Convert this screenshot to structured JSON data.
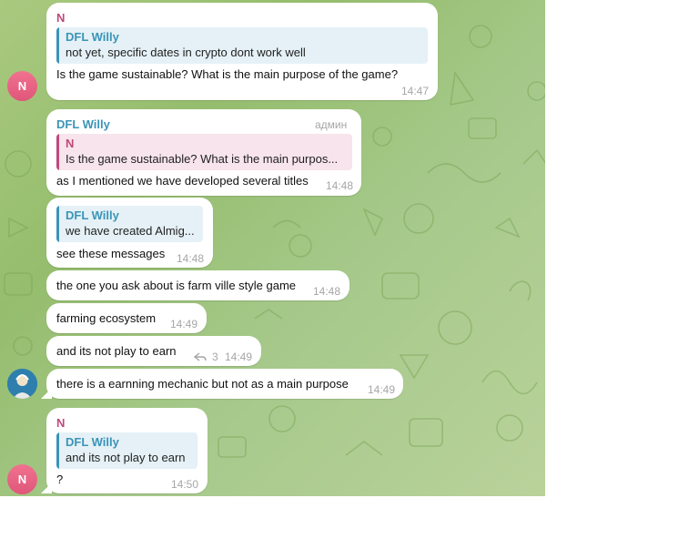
{
  "messages": [
    {
      "sender": "N",
      "quote": {
        "author": "DFL Willy",
        "text": "not yet, specific dates in crypto dont work well"
      },
      "text": "Is the game sustainable? What is the main purpose of the game?",
      "time": "14:47",
      "avatar": "N"
    },
    {
      "sender": "DFL Willy",
      "role": "админ",
      "quote": {
        "author": "N",
        "text": "Is the game sustainable? What is the main purpos..."
      },
      "text": "as I mentioned we have developed several titles",
      "time": "14:48"
    },
    {
      "quote": {
        "author": "DFL Willy",
        "text": "we have created Almig..."
      },
      "text": "see these messages",
      "time": "14:48"
    },
    {
      "text": "the one you ask about is farm ville style game",
      "time": "14:48"
    },
    {
      "text": "farming ecosystem",
      "time": "14:49"
    },
    {
      "text": "and its not play to earn",
      "replies": "3",
      "time": "14:49"
    },
    {
      "text": "there is a earnning mechanic but not as a main purpose",
      "time": "14:49"
    },
    {
      "sender": "N",
      "quote": {
        "author": "DFL Willy",
        "text": "and its not play to earn"
      },
      "text": "?",
      "time": "14:50",
      "avatar": "N"
    }
  ],
  "colors": {
    "sender_n": "#c0487a",
    "sender_dfl": "#3a94b8",
    "background": "#a9c97f"
  }
}
